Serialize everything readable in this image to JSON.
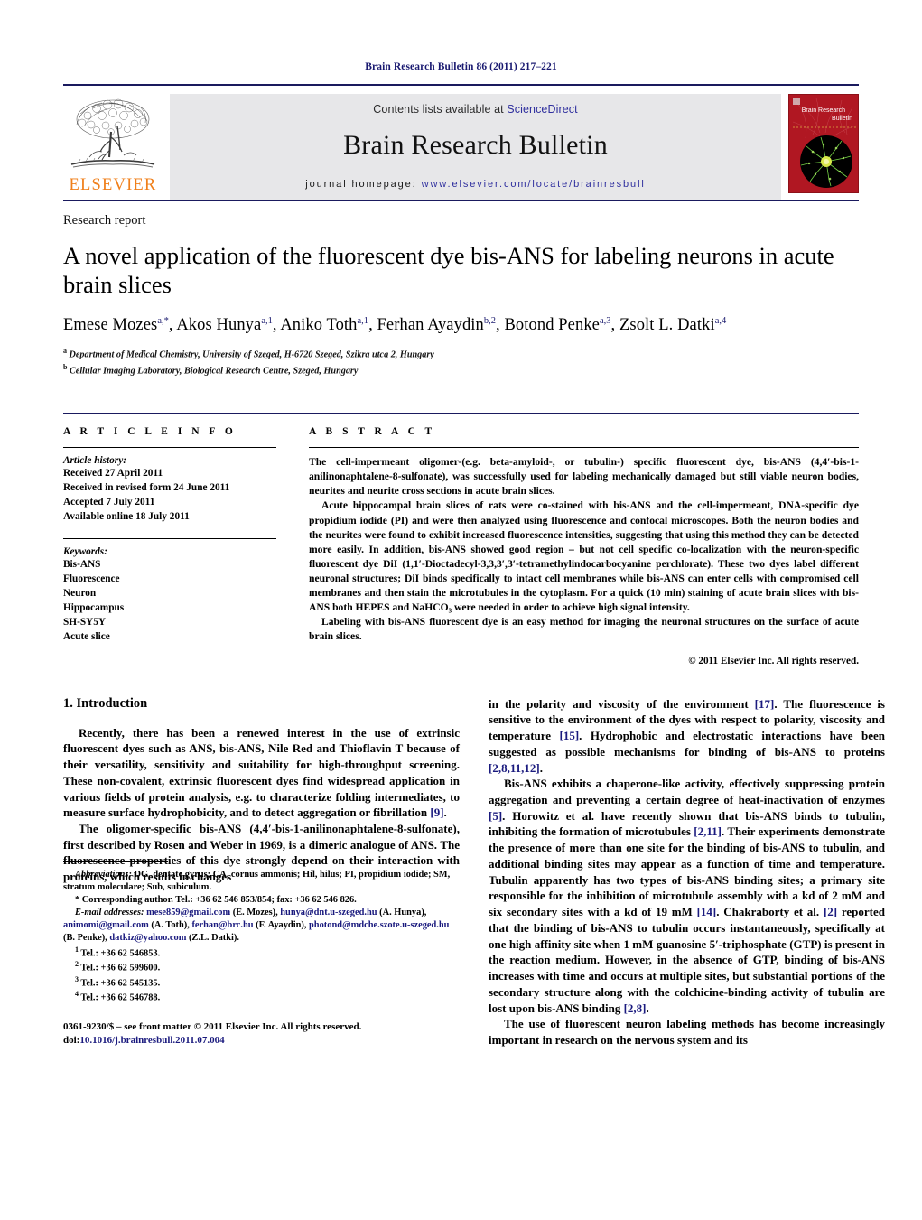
{
  "running_head": "Brain Research Bulletin 86 (2011) 217–221",
  "masthead": {
    "publisher_name": "ELSEVIER",
    "contents_prefix": "Contents lists available at ",
    "contents_link": "ScienceDirect",
    "journal_title": "Brain Research Bulletin",
    "homepage_prefix": "journal homepage: ",
    "homepage_url": "www.elsevier.com/locate/brainresbull",
    "cover_title_line1": "Brain Research",
    "cover_title_line2": "Bulletin"
  },
  "article": {
    "type": "Research report",
    "title": "A novel application of the fluorescent dye bis-ANS for labeling neurons in acute brain slices",
    "authors_html": "Emese Mozes<sup>a,*</sup>, Akos Hunya<sup>a,1</sup>, Aniko Toth<sup>a,1</sup>, Ferhan Ayaydin<sup>b,2</sup>, Botond Penke<sup>a,3</sup>, Zsolt L. Datki<sup>a,4</sup>",
    "affiliation_a": "Department of Medical Chemistry, University of Szeged, H-6720 Szeged, Szikra utca 2, Hungary",
    "affiliation_b": "Cellular Imaging Laboratory, Biological Research Centre, Szeged, Hungary"
  },
  "info": {
    "heading": "A R T I C L E    I N F O",
    "history_label": "Article history:",
    "history": [
      "Received 27 April 2011",
      "Received in revised form 24 June 2011",
      "Accepted 7 July 2011",
      "Available online 18 July 2011"
    ],
    "keywords_label": "Keywords:",
    "keywords": [
      "Bis-ANS",
      "Fluorescence",
      "Neuron",
      "Hippocampus",
      "SH-SY5Y",
      "Acute slice"
    ]
  },
  "abstract": {
    "heading": "A B S T R A C T",
    "paragraphs": [
      "The cell-impermeant oligomer-(e.g. beta-amyloid-, or tubulin-) specific fluorescent dye, bis-ANS (4,4′-bis-1-anilinonaphtalene-8-sulfonate), was successfully used for labeling mechanically damaged but still viable neuron bodies, neurites and neurite cross sections in acute brain slices.",
      "Acute hippocampal brain slices of rats were co-stained with bis-ANS and the cell-impermeant, DNA-specific dye propidium iodide (PI) and were then analyzed using fluorescence and confocal microscopes. Both the neuron bodies and the neurites were found to exhibit increased fluorescence intensities, suggesting that using this method they can be detected more easily. In addition, bis-ANS showed good region – but not cell specific co-localization with the neuron-specific fluorescent dye DiI (1,1′-Dioctadecyl-3,3,3′,3′-tetramethylindocarbocyanine perchlorate). These two dyes label different neuronal structures; DiI binds specifically to intact cell membranes while bis-ANS can enter cells with compromised cell membranes and then stain the microtubules in the cytoplasm. For a quick (10 min) staining of acute brain slices with bis-ANS both HEPES and NaHCO₃ were needed in order to achieve high signal intensity.",
      "Labeling with bis-ANS fluorescent dye is an easy method for imaging the neuronal structures on the surface of acute brain slices."
    ],
    "copyright": "© 2011 Elsevier Inc. All rights reserved."
  },
  "body": {
    "section_heading": "1.  Introduction",
    "left_paragraphs": [
      "Recently, there has been a renewed interest in the use of extrinsic fluorescent dyes such as ANS, bis-ANS, Nile Red and Thioflavin T because of their versatility, sensitivity and suitability for high-throughput screening. These non-covalent, extrinsic fluorescent dyes find widespread application in various fields of protein analysis, e.g. to characterize folding intermediates, to measure surface hydrophobicity, and to detect aggregation or fibrillation [9].",
      "The oligomer-specific bis-ANS (4,4′-bis-1-anilinonaphtalene-8-sulfonate), first described by Rosen and Weber in 1969, is a dimeric analogue of ANS. The fluorescence properties of this dye strongly depend on their interaction with proteins, which results in changes"
    ],
    "right_paragraphs": [
      "in the polarity and viscosity of the environment [17]. The fluorescence is sensitive to the environment of the dyes with respect to polarity, viscosity and temperature [15]. Hydrophobic and electrostatic interactions have been suggested as possible mechanisms for binding of bis-ANS to proteins [2,8,11,12].",
      "Bis-ANS exhibits a chaperone-like activity, effectively suppressing protein aggregation and preventing a certain degree of heat-inactivation of enzymes [5]. Horowitz et al. have recently shown that bis-ANS binds to tubulin, inhibiting the formation of microtubules [2,11]. Their experiments demonstrate the presence of more than one site for the binding of bis-ANS to tubulin, and additional binding sites may appear as a function of time and temperature. Tubulin apparently has two types of bis-ANS binding sites; a primary site responsible for the inhibition of microtubule assembly with a kd of 2 mM and six secondary sites with a kd of 19 mM [14]. Chakraborty et al. [2] reported that the binding of bis-ANS to tubulin occurs instantaneously, specifically at one high affinity site when 1 mM guanosine 5′-triphosphate (GTP) is present in the reaction medium. However, in the absence of GTP, binding of bis-ANS increases with time and occurs at multiple sites, but substantial portions of the secondary structure along with the colchicine-binding activity of tubulin are lost upon bis-ANS binding [2,8].",
      "The use of fluorescent neuron labeling methods has become increasingly important in research on the nervous system and its"
    ]
  },
  "footnotes": {
    "abbreviations_label": "Abbreviations:",
    "abbreviations_text": " DG, dentate gyrus; CA, cornus ammonis; Hil, hilus; PI, propidium iodide; SM, stratum moleculare; Sub, subiculum.",
    "corresponding": "* Corresponding author. Tel.: +36 62 546 853/854; fax: +36 62 546 826.",
    "email_label": "E-mail addresses:",
    "emails_html": " <span class=\"mail\">mese859@gmail.com</span> (E. Mozes), <span class=\"mail\">hunya@dnt.u-szeged.hu</span> (A. Hunya), <span class=\"mail\">animomi@gmail.com</span> (A. Toth), <span class=\"mail\">ferhan@brc.hu</span> (F. Ayaydin), <span class=\"mail\">photond@mdche.szote.u-szeged.hu</span> (B. Penke), <span class=\"mail\">datkiz@yahoo.com</span> (Z.L. Datki).",
    "tels": [
      "Tel.: +36 62 546853.",
      "Tel.: +36 62 599600.",
      "Tel.: +36 62 545135.",
      "Tel.: +36 62 546788."
    ],
    "issn_line": "0361-9230/$ – see front matter © 2011 Elsevier Inc. All rights reserved.",
    "doi_prefix": "doi:",
    "doi_value": "10.1016/j.brainresbull.2011.07.004"
  }
}
